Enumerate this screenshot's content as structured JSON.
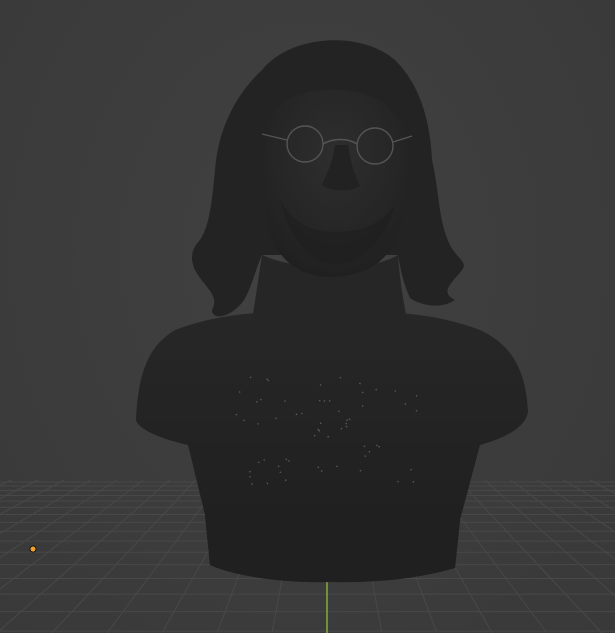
{
  "viewport": {
    "background_color": "#3d3d3d",
    "grid_color": "#4a4a4a",
    "y_axis_color": "#7fae3a",
    "mesh_color": "#242424",
    "mesh_highlight": "#2d2d2d",
    "origin_marker_color": "#f0a030",
    "object_type": "sculpted-bust-mesh",
    "icons": [
      "origin-point-icon"
    ]
  }
}
